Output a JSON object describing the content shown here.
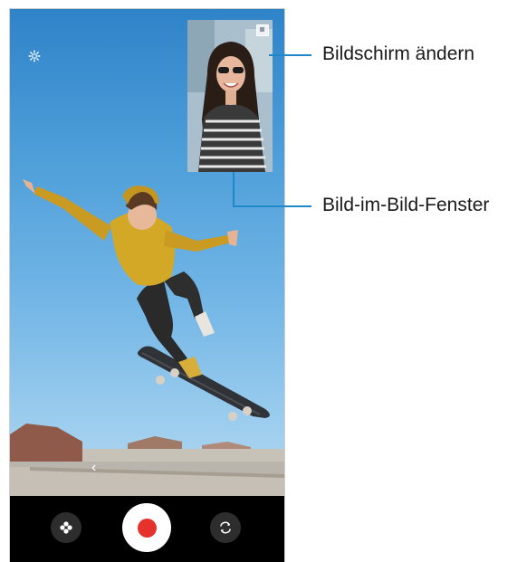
{
  "callouts": {
    "screen_switch": "Bildschirm ändern",
    "pip_window": "Bild-im-Bild-Fenster"
  },
  "icons": {
    "settings": "gear-icon",
    "screen_switch": "switch-screen-icon",
    "back": "chevron-left-icon",
    "effects": "effects-icon",
    "record": "record-icon",
    "flip_camera": "flip-camera-icon"
  },
  "glyphs": {
    "back": "‹"
  },
  "colors": {
    "accent_leader": "#1e88c8",
    "record": "#e5322d",
    "controls_bg": "#000000"
  }
}
